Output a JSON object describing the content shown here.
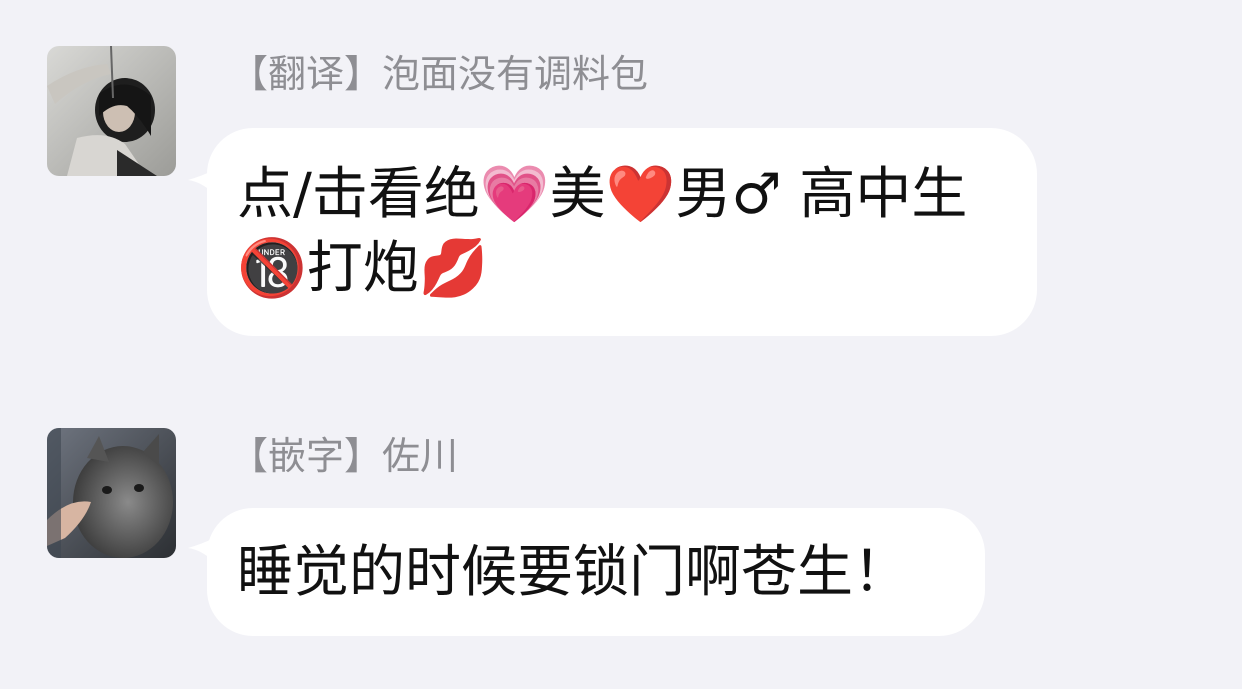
{
  "messages": [
    {
      "sender": "【翻译】泡面没有调料包",
      "text": "点/击看绝💗美❤️男♂ 高中生🔞打炮💋",
      "avatar": "avatar-person-photo"
    },
    {
      "sender": "【嵌字】佐川",
      "text": "睡觉的时候要锁门啊苍生！",
      "avatar": "avatar-cat-photo"
    }
  ],
  "colors": {
    "background": "#f2f2f7",
    "bubble": "#ffffff",
    "sender_text": "#8e8e93",
    "message_text": "#111111"
  }
}
